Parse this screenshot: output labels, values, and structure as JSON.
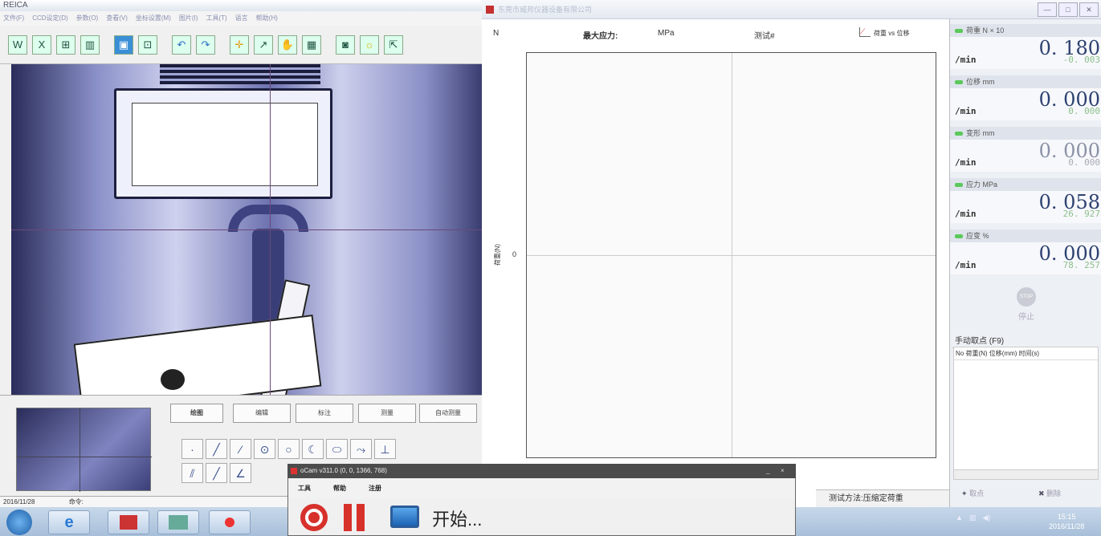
{
  "left_app": {
    "title": "REICA",
    "menu": [
      "文件(F)",
      "CCD设定(D)",
      "参数(O)",
      "查看(V)",
      "坐标设置(M)",
      "图片(I)",
      "工具(T)",
      "语言",
      "帮助(H)"
    ],
    "toolbar_icons": [
      "w-icon",
      "x-icon",
      "capture-icon",
      "chart-icon",
      "blue-icon",
      "measure-icon",
      "undo-icon",
      "redo-icon",
      "crosshair-icon",
      "draw-icon",
      "hand-icon",
      "grid-icon",
      "camera-icon",
      "lamp-icon",
      "fit-icon"
    ],
    "tabs": [
      "绘图",
      "编辑",
      "标注",
      "测量",
      "自动测量"
    ],
    "tools_row1": [
      "·",
      "╱",
      "⁄",
      "⊙",
      "○",
      "☾",
      "⬭",
      "⤳",
      "⊥"
    ],
    "tools_row2": [
      "⫽",
      "╱",
      "∠"
    ],
    "status_date": "2016/11/28",
    "status_command": "命令:"
  },
  "chart_app": {
    "title": "东莞市威邦仪器设备有限公司",
    "unit_left": "N",
    "max_stress_label": "最大应力:",
    "max_stress_unit": "MPa",
    "test_label": "测试#",
    "curve_select": "荷重 vs 位移",
    "y_axis_label": "荷重(N)",
    "y_tick": "0",
    "footer": "测试方法:压缩定荷重",
    "window_controls": [
      "—",
      "□",
      "✕"
    ]
  },
  "right_panel": {
    "measures": [
      {
        "header": "荷重 N × 10",
        "value": "0. 180",
        "sub": "-0. 003",
        "unit": "/min"
      },
      {
        "header": "位移 mm",
        "value": "0. 000",
        "sub": "0. 000",
        "unit": "/min"
      },
      {
        "header": "变形 mm",
        "value": "0. 000",
        "sub": "0. 000",
        "unit": "/min"
      },
      {
        "header": "应力 MPa",
        "value": "0. 058",
        "sub": "26. 927",
        "unit": "/min"
      },
      {
        "header": "应变 %",
        "value": "0. 000",
        "sub": "78. 257",
        "unit": "/min"
      }
    ],
    "stop_icon_text": "STOP",
    "stop_label": "停止",
    "manual_header": "手动取点 (F9)",
    "table_cols": "No 荷重(N) 位移(mm) 时间(s)",
    "btn_add": "取点",
    "btn_delete": "删除"
  },
  "ocam": {
    "title": "oCam v311.0 (0, 0, 1366, 768)",
    "menu": [
      "工具",
      "帮助",
      "注册"
    ],
    "start_label": "开始...",
    "minimize": "_",
    "close": "×"
  },
  "taskbar": {
    "time": "15:15",
    "date": "2016/11/28"
  }
}
